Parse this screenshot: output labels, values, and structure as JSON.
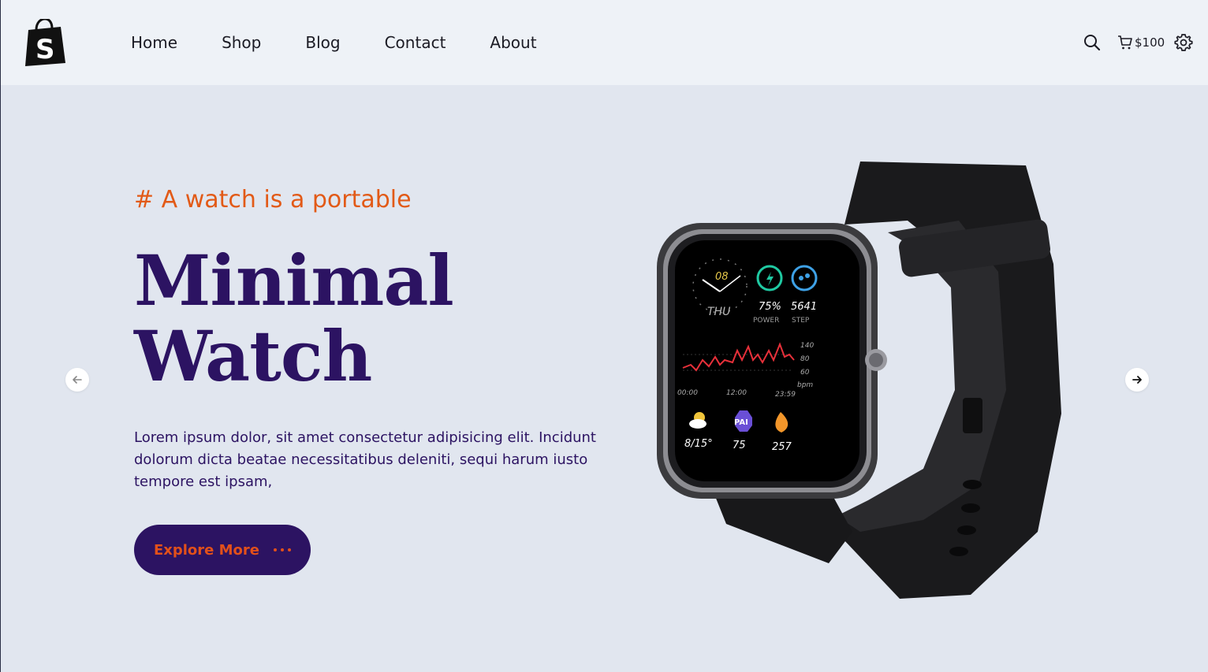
{
  "nav": {
    "logo_letter": "S",
    "links": [
      "Home",
      "Shop",
      "Blog",
      "Contact",
      "About"
    ],
    "cart_amount": "$100",
    "icons": [
      "search-icon",
      "cart-icon",
      "gear-icon"
    ]
  },
  "hero": {
    "tagline": "# A watch is a portable",
    "title_line1": "Minimal",
    "title_line2": "Watch",
    "description": "Lorem ipsum dolor, sit amet consectetur adipisicing elit. Incidunt dolorum dicta beatae necessitatibus deleniti, sequi harum iusto tempore est ipsam,",
    "cta_label": "Explore More"
  },
  "slider": {
    "prev_icon": "arrow-left-icon",
    "next_icon": "arrow-right-icon"
  },
  "watch_face": {
    "hour": "08",
    "day": "THU",
    "power_value": "75%",
    "power_label": "POWER",
    "step_value": "5641",
    "step_label": "STEP",
    "hr_scale": [
      "140",
      "80",
      "60",
      "bpm"
    ],
    "times": [
      "00:00",
      "12:00",
      "23:59"
    ],
    "weather": "8/15°",
    "pai_badge": "PAI",
    "pai_value": "75",
    "calories": "257"
  },
  "colors": {
    "accent": "#e25a17",
    "primary": "#2c1362",
    "background": "#e1e6ef",
    "navbar": "#eef2f7"
  }
}
